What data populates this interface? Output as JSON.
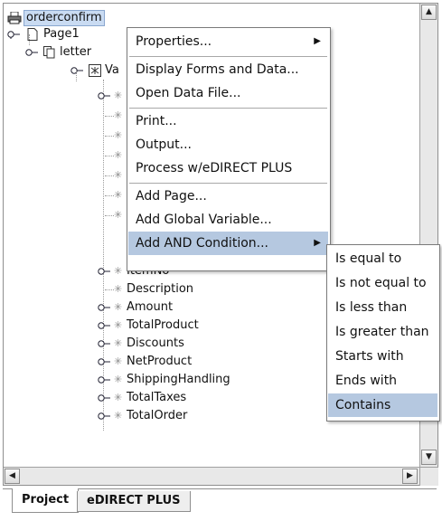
{
  "tree": {
    "root": "orderconfirm",
    "page": "Page1",
    "letter": "letter",
    "var_partial": "Va",
    "hidden_rows": 7,
    "item_partial": "ItemNo",
    "fields": [
      {
        "label": "Description",
        "expandable": false
      },
      {
        "label": "Amount",
        "expandable": true
      },
      {
        "label": "TotalProduct",
        "expandable": true
      },
      {
        "label": "Discounts",
        "expandable": true
      },
      {
        "label": "NetProduct",
        "expandable": true
      },
      {
        "label": "ShippingHandling",
        "expandable": true
      },
      {
        "label": "TotalTaxes",
        "expandable": true
      },
      {
        "label": "TotalOrder",
        "expandable": true
      }
    ]
  },
  "context_menu": {
    "items": [
      "Properties...",
      "Display Forms and Data...",
      "Open Data File...",
      "Print...",
      "Output...",
      "Process w/eDIRECT PLUS",
      "Add Page...",
      "Add Global Variable...",
      "Add AND Condition..."
    ],
    "highlighted": "Add AND Condition..."
  },
  "submenu": {
    "items": [
      "Is equal to",
      "Is not equal to",
      "Is less than",
      "Is greater than",
      "Starts with",
      "Ends with",
      "Contains"
    ],
    "highlighted": "Contains"
  },
  "tabs": [
    "Project",
    "eDIRECT PLUS"
  ],
  "active_tab": "Project",
  "colors": {
    "highlight": "#b5c8e0",
    "selection": "#c9dbf2"
  }
}
